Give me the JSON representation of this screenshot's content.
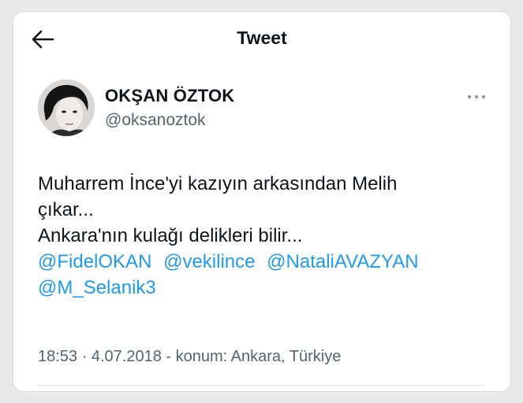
{
  "header": {
    "title": "Tweet",
    "back_icon": "arrow-left-icon"
  },
  "author": {
    "display_name": "OKŞAN ÖZTOK",
    "username": "@oksanoztok",
    "avatar": "avatar-photo",
    "more_icon": "more-horizontal-icon"
  },
  "tweet": {
    "line1": "Muharrem İnce'yi kazıyın arkasından Melih",
    "line2": "çıkar...",
    "line3": "Ankara'nın kulağı delikleri bilir...",
    "mentions": [
      "@FidelOKAN",
      "@vekilince",
      "@NataliAVAZYAN",
      "@M_Selanik3"
    ]
  },
  "meta": {
    "time": "18:53",
    "date": "4.07.2018",
    "location_prefix": "konum:",
    "location": "Ankara, Türkiye"
  },
  "colors": {
    "accent": "#1d9bf0",
    "text": "#0f1419",
    "secondary": "#536471"
  }
}
